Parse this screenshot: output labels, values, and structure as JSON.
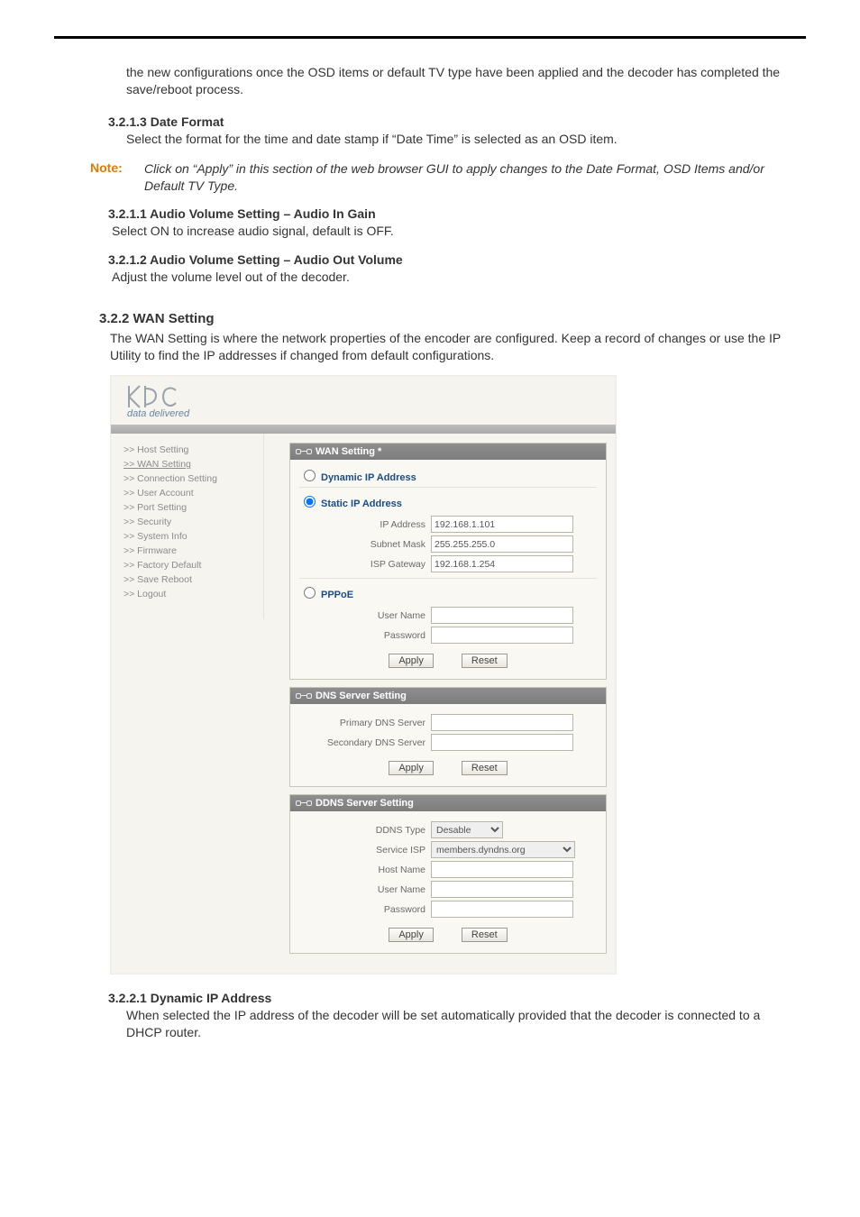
{
  "intro_para": "the new configurations once the OSD items or default TV type have been applied and the decoder has completed the save/reboot process.",
  "s_date_format": {
    "heading": "3.2.1.3 Date Format",
    "text": "Select the format for the time and date stamp if “Date Time” is selected as an OSD item."
  },
  "note": {
    "label": "Note:",
    "text": "Click on “Apply” in this section of the web browser GUI to apply changes to the Date Format, OSD Items and/or Default TV Type."
  },
  "s_audio_in": {
    "heading": "3.2.1.1 Audio Volume Setting – Audio In Gain",
    "text": "Select ON to increase audio signal, default is OFF."
  },
  "s_audio_out": {
    "heading": "3.2.1.2 Audio Volume Setting – Audio Out Volume",
    "text": "Adjust the volume level out of the decoder."
  },
  "s_wan": {
    "heading": "3.2.2 WAN Setting",
    "text": "The WAN Setting is where the network properties of the encoder are configured. Keep a record of changes or use the IP Utility to find the IP addresses if changed from default configurations."
  },
  "s_dyn": {
    "heading": "3.2.2.1 Dynamic IP Address",
    "text": "When selected the IP address of the decoder will be set automatically provided that the decoder is connected to a DHCP router."
  },
  "ui": {
    "brand_tag": "data delivered",
    "side": [
      ">>  Host Setting",
      ">>  WAN Setting",
      ">>  Connection Setting",
      ">>  User Account",
      ">>  Port Setting",
      ">>  Security",
      ">>  System Info",
      ">>  Firmware",
      ">>  Factory Default",
      ">>  Save Reboot",
      ">>  Logout"
    ],
    "panel1_title": "WAN Setting *",
    "opt_dynamic": "Dynamic IP Address",
    "opt_static": "Static IP Address",
    "ip_label": "IP Address",
    "ip_val": "192.168.1.101",
    "mask_label": "Subnet Mask",
    "mask_val": "255.255.255.0",
    "gw_label": "ISP Gateway",
    "gw_val": "192.168.1.254",
    "opt_pppoe": "PPPoE",
    "user_label": "User Name",
    "pass_label": "Password",
    "apply": "Apply",
    "reset": "Reset",
    "panel2_title": "DNS Server Setting",
    "pdns_label": "Primary DNS Server",
    "sdns_label": "Secondary DNS Server",
    "panel3_title": "DDNS Server Setting",
    "ddns_type_label": "DDNS Type",
    "ddns_type_val": "Desable",
    "svc_isp_label": "Service ISP",
    "svc_isp_val": "members.dyndns.org",
    "host_label": "Host Name"
  }
}
